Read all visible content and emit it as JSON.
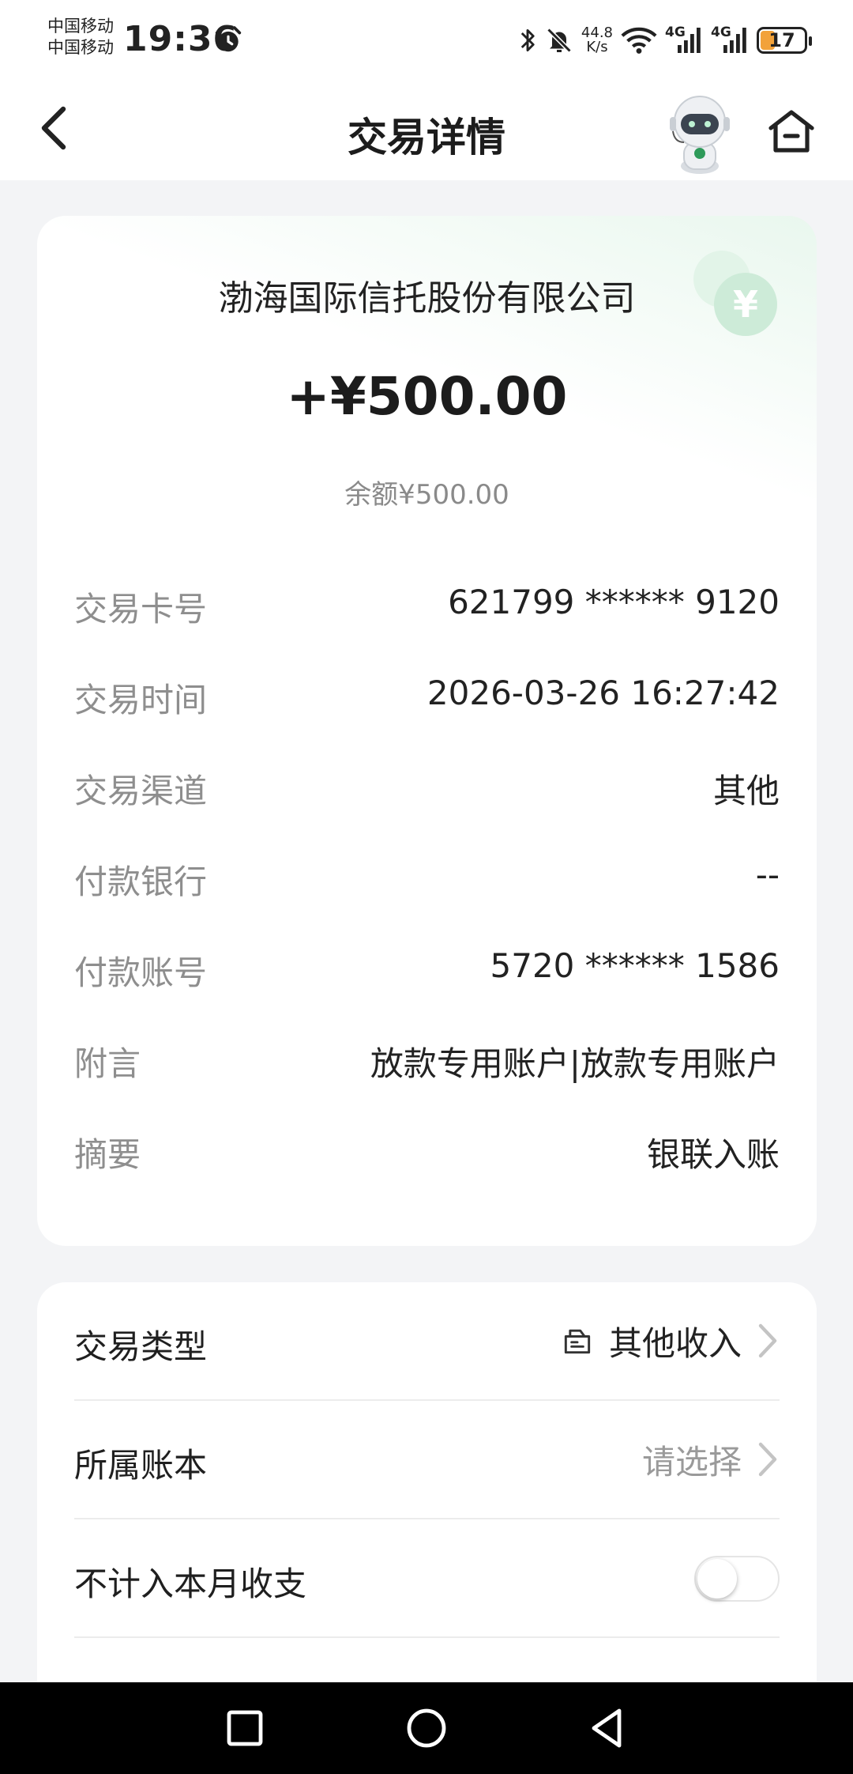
{
  "status_bar": {
    "carrier_1": "中国移动",
    "carrier_2": "中国移动",
    "time": "19:36",
    "net_speed_value": "44.8",
    "net_speed_unit": "K/s",
    "signal_1_label": "4G",
    "signal_2_label": "4G",
    "battery_level": "17"
  },
  "header": {
    "title": "交易详情"
  },
  "transaction": {
    "merchant": "渤海国际信托股份有限公司",
    "amount": "+¥500.00",
    "balance": "余额¥500.00",
    "details": [
      {
        "label": "交易卡号",
        "value": "621799 ****** 9120"
      },
      {
        "label": "交易时间",
        "value": "2026-03-26 16:27:42"
      },
      {
        "label": "交易渠道",
        "value": "其他"
      },
      {
        "label": "付款银行",
        "value": "--"
      },
      {
        "label": "付款账号",
        "value": "5720 ****** 1586"
      },
      {
        "label": "附言",
        "value": "放款专用账户|放款专用账户"
      },
      {
        "label": "摘要",
        "value": "银联入账"
      }
    ]
  },
  "settings": {
    "type_label": "交易类型",
    "type_value": "其他收入",
    "book_label": "所属账本",
    "book_value": "请选择",
    "exclude_label": "不计入本月收支",
    "exclude_enabled": false
  },
  "colors": {
    "accent_green": "#27b06a",
    "coin_green": "#c9ebd6",
    "battery_orange": "#f2a23a"
  }
}
